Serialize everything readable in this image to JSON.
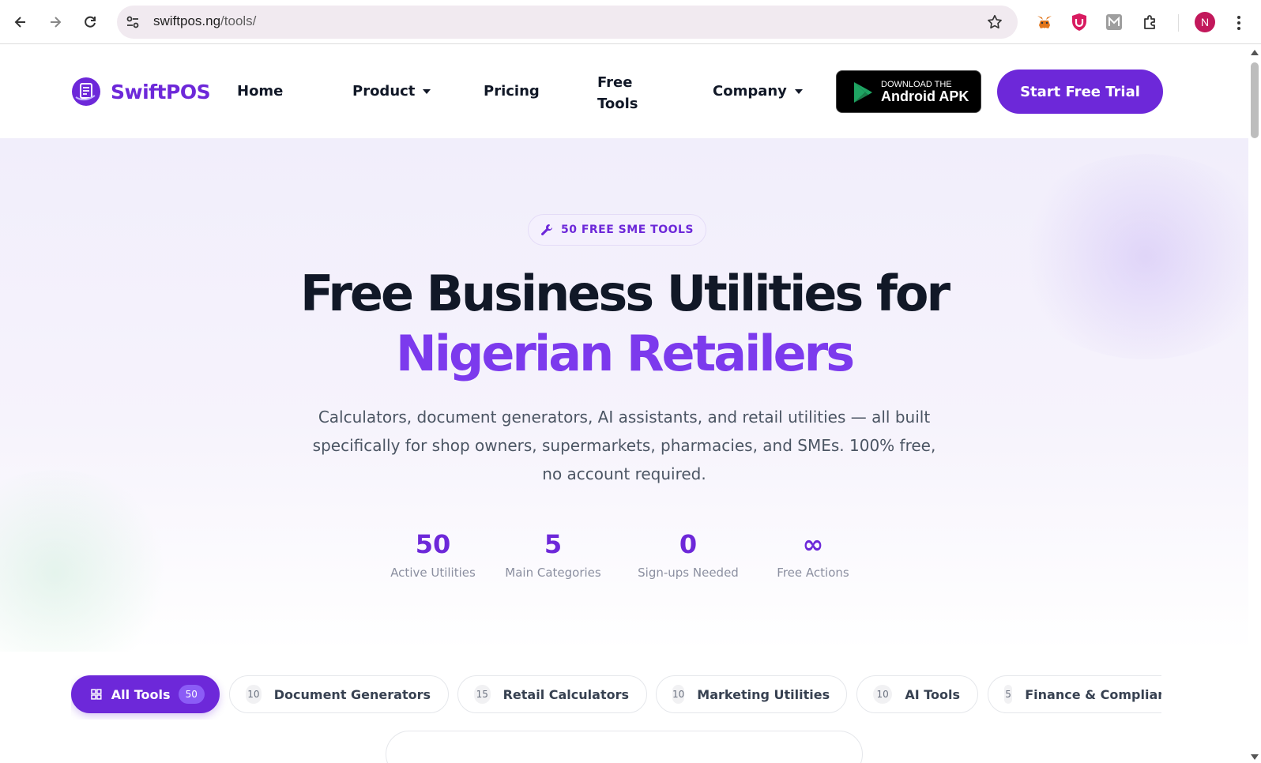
{
  "browser": {
    "url_host": "swiftpos.ng",
    "url_path": "/tools/",
    "profile_initial": "N"
  },
  "site": {
    "logo_text": "SwiftPOS",
    "nav": {
      "home": "Home",
      "product": "Product",
      "pricing": "Pricing",
      "free_tools_line1": "Free",
      "free_tools_line2": "Tools",
      "company": "Company"
    },
    "apk_small": "DOWNLOAD THE",
    "apk_big": "Android APK",
    "trial_button": "Start Free Trial"
  },
  "hero": {
    "badge": "50 FREE SME TOOLS",
    "headline_line1": "Free Business Utilities for",
    "headline_line2": "Nigerian Retailers",
    "lead": "Calculators, document generators, AI assistants, and retail utilities — all built specifically for shop owners, supermarkets, pharmacies, and SMEs. 100% free, no account required.",
    "stats": [
      {
        "value": "50",
        "label": "Active Utilities"
      },
      {
        "value": "5",
        "label": "Main Categories"
      },
      {
        "value": "0",
        "label": "Sign-ups Needed"
      },
      {
        "value": "∞",
        "label": "Free Actions"
      }
    ]
  },
  "filters": [
    {
      "label": "All Tools",
      "count": "50",
      "active": true
    },
    {
      "label": "Document Generators",
      "count": "10"
    },
    {
      "label": "Retail Calculators",
      "count": "15"
    },
    {
      "label": "Marketing Utilities",
      "count": "10"
    },
    {
      "label": "AI Tools",
      "count": "10"
    },
    {
      "label": "Finance & Compliance",
      "count": "5"
    }
  ],
  "colors": {
    "brand": "#6d28d9",
    "accent": "#7c3aed"
  }
}
